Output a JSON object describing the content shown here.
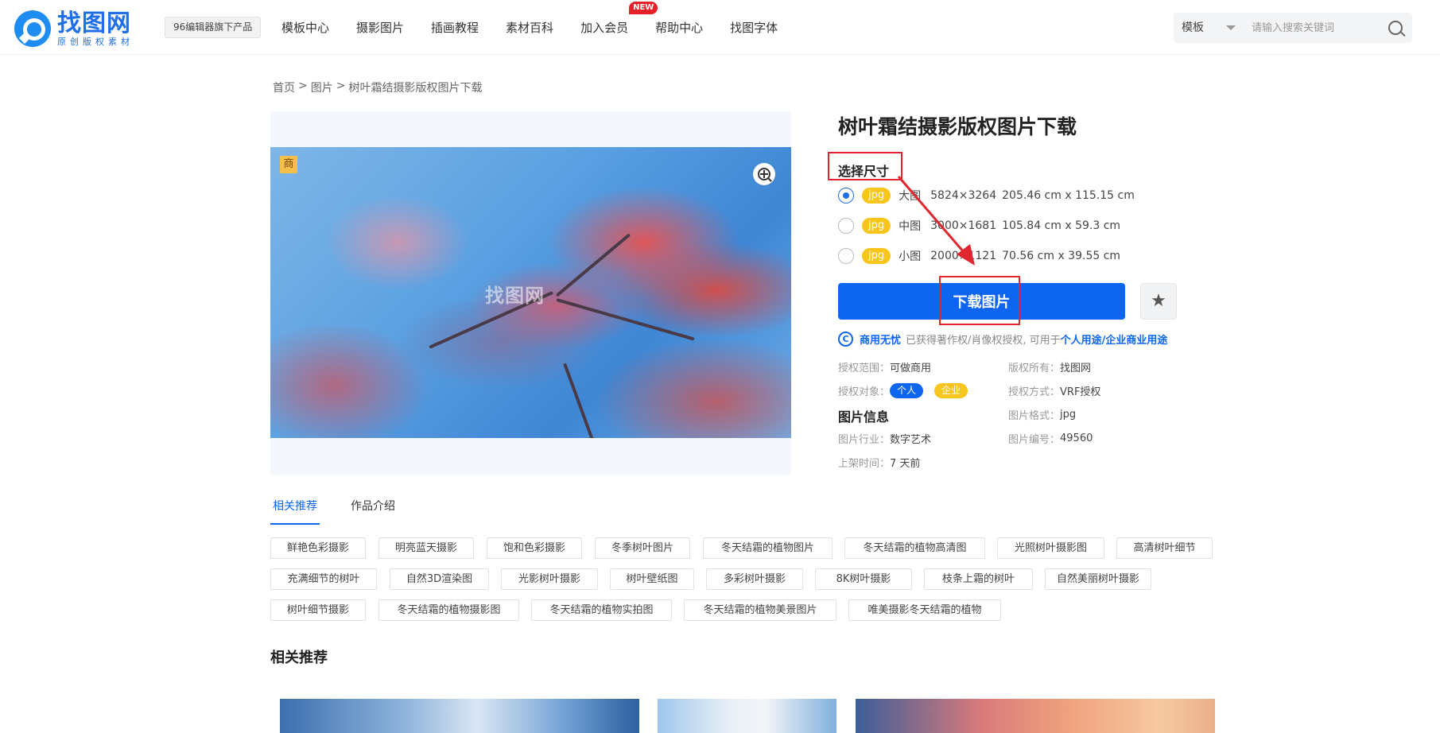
{
  "header": {
    "logo_title": "找图网",
    "logo_sub": "原创版权素材",
    "badge": "96编辑器旗下产品",
    "nav": [
      {
        "label": "模板中心"
      },
      {
        "label": "摄影图片"
      },
      {
        "label": "插画教程"
      },
      {
        "label": "素材百科"
      },
      {
        "label": "加入会员",
        "tag": "NEW"
      },
      {
        "label": "帮助中心"
      },
      {
        "label": "找图字体"
      }
    ],
    "search": {
      "select": "模板",
      "placeholder": "请输入搜索关键词"
    }
  },
  "breadcrumb": [
    "首页",
    ">",
    "图片",
    ">",
    "树叶霜结摄影版权图片下载"
  ],
  "preview": {
    "corner_tag": "商",
    "watermark": "找图网"
  },
  "detail": {
    "title": "树叶霜结摄影版权图片下载",
    "size_label": "选择尺寸",
    "sizes": [
      {
        "format": "jpg",
        "name": "大图",
        "px": "5824×3264",
        "cm": "205.46 cm x 115.15 cm",
        "selected": true
      },
      {
        "format": "jpg",
        "name": "中图",
        "px": "3000×1681",
        "cm": "105.84 cm x 59.3 cm",
        "selected": false
      },
      {
        "format": "jpg",
        "name": "小图",
        "px": "2000×1121",
        "cm": "70.56 cm x 39.55 cm",
        "selected": false
      }
    ],
    "download_label": "下载图片",
    "star_label": "★",
    "license": {
      "icon": "C",
      "strong": "商用无忧",
      "text": "已获得著作权/肖像权授权, 可用于",
      "link": "个人用途/企业商业用途"
    },
    "scope_label": "授权范围：",
    "scope_value": "可做商用",
    "owner_label": "版权所有：",
    "owner_value": "找图网",
    "target_label": "授权对象：",
    "target_personal": "个人",
    "target_company": "企业",
    "method_label": "授权方式：",
    "method_value": "VRF授权",
    "info_heading": "图片信息",
    "format_label": "图片格式：",
    "format_value": "jpg",
    "industry_label": "图片行业：",
    "industry_value": "数字艺术",
    "number_label": "图片编号：",
    "number_value": "49560",
    "time_label": "上架时间：",
    "time_value": "7 天前"
  },
  "tabs": [
    {
      "label": "相关推荐",
      "active": true
    },
    {
      "label": "作品介绍",
      "active": false
    }
  ],
  "keywords": [
    [
      "鲜艳色彩摄影",
      "明亮蓝天摄影",
      "饱和色彩摄影",
      "冬季树叶图片",
      "冬天结霜的植物图片",
      "冬天结霜的植物高清图",
      "光照树叶摄影图",
      "高清树叶细节"
    ],
    [
      "充满细节的树叶",
      "自然3D渲染图",
      "光影树叶摄影",
      "树叶壁纸图",
      "多彩树叶摄影",
      "8K树叶摄影",
      "枝条上霜的树叶",
      "自然美丽树叶摄影"
    ],
    [
      "树叶细节摄影",
      "冬天结霜的植物摄影图",
      "冬天结霜的植物实拍图",
      "冬天结霜的植物美景图片",
      "唯美摄影冬天结霜的植物"
    ]
  ],
  "related_title": "相关推荐",
  "colors": {
    "accent": "#0e66f0",
    "annotation": "#e0262f",
    "tag_yellow": "#f7c51b"
  }
}
